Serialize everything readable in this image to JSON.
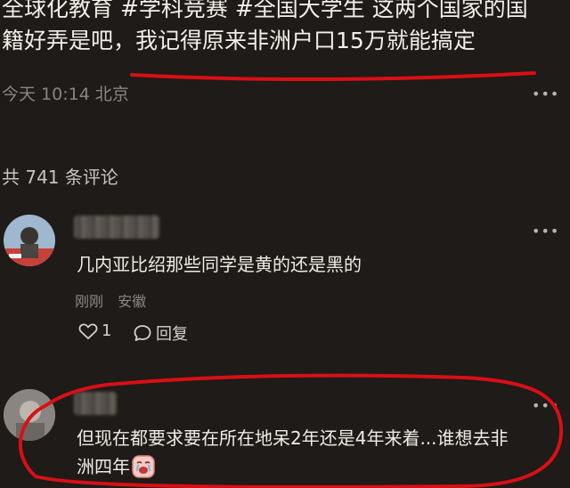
{
  "post": {
    "line1": "全球化教育 #学科竞赛 #全国大学生  这两个国家的国",
    "line2": "籍好弄是吧，我记得原来非洲户口15万就能搞定",
    "timestamp": "今天 10:14 北京"
  },
  "comments_section": {
    "count_label": "共 741 条评论"
  },
  "comments": [
    {
      "text": "几内亚比绍那些同学是黄的还是黑的",
      "time": "刚刚",
      "location": "安徽",
      "like_count": "1",
      "reply_label": "回复"
    },
    {
      "text_line1": "但现在都要求要在所在地呆2年还是4年来着...谁想去非",
      "text_line2": "洲四年"
    }
  ],
  "colors": {
    "background": "#1e1b18",
    "annotation_red": "#d90f16"
  },
  "icons": [
    "more-dots-icon",
    "heart-icon",
    "comment-bubble-icon",
    "crying-emoji-icon"
  ]
}
